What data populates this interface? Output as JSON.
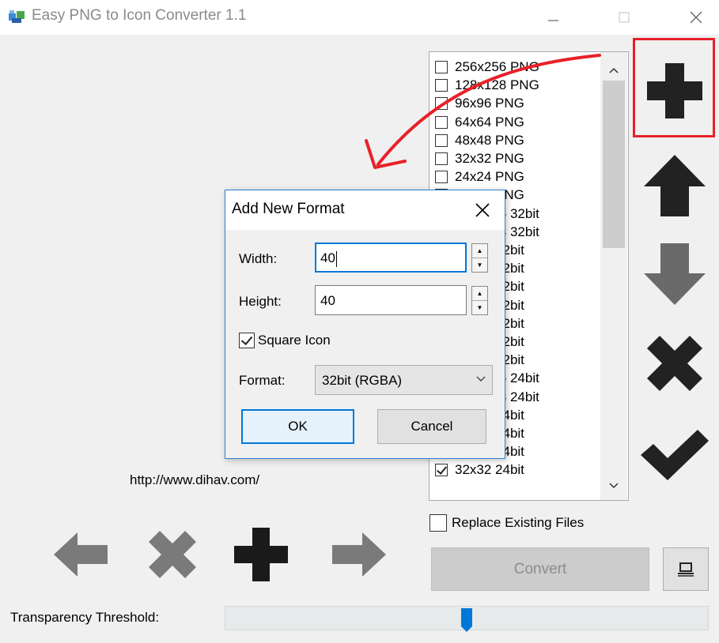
{
  "window": {
    "title": "Easy PNG to Icon Converter 1.1",
    "minimize_icon": "minimize-icon",
    "maximize_icon": "maximize-icon",
    "close_icon": "close-icon"
  },
  "format_list": {
    "items": [
      {
        "label": "256x256 PNG",
        "checked": false
      },
      {
        "label": "128x128 PNG",
        "checked": false
      },
      {
        "label": "96x96 PNG",
        "checked": false
      },
      {
        "label": "64x64 PNG",
        "checked": false
      },
      {
        "label": "48x48 PNG",
        "checked": false
      },
      {
        "label": "32x32 PNG",
        "checked": false
      },
      {
        "label": "24x24 PNG",
        "checked": false
      },
      {
        "label": "16x16 PNG",
        "checked": false
      },
      {
        "label": "256x256 32bit",
        "checked": false
      },
      {
        "label": "128x128 32bit",
        "checked": false
      },
      {
        "label": "96x96 32bit",
        "checked": false
      },
      {
        "label": "64x64 32bit",
        "checked": false
      },
      {
        "label": "48x48 32bit",
        "checked": false
      },
      {
        "label": "40x40 32bit",
        "checked": false
      },
      {
        "label": "32x32 32bit",
        "checked": false
      },
      {
        "label": "24x24 32bit",
        "checked": false
      },
      {
        "label": "16x16 32bit",
        "checked": false
      },
      {
        "label": "256x256 24bit",
        "checked": false
      },
      {
        "label": "128x128 24bit",
        "checked": false
      },
      {
        "label": "96x96 24bit",
        "checked": false
      },
      {
        "label": "64x64 24bit",
        "checked": false
      },
      {
        "label": "48x48 24bit",
        "checked": true
      },
      {
        "label": "32x32 24bit",
        "checked": true
      }
    ]
  },
  "side_toolbar": {
    "add_icon": "plus-icon",
    "up_icon": "arrow-up-icon",
    "down_icon": "arrow-down-icon",
    "delete_icon": "x-icon",
    "apply_icon": "checkmark-icon",
    "highlight_color": "#e8202a"
  },
  "dialog": {
    "title": "Add New Format",
    "width_label": "Width:",
    "width_value": "40",
    "height_label": "Height:",
    "height_value": "40",
    "square_label": "Square Icon",
    "square_checked": true,
    "format_label": "Format:",
    "format_value": "32bit (RGBA)",
    "ok_label": "OK",
    "cancel_label": "Cancel",
    "accent_color": "#0078d7"
  },
  "main": {
    "url": "http://www.dihav.com/",
    "replace_label": "Replace Existing Files",
    "replace_checked": false,
    "convert_label": "Convert",
    "threshold_label": "Transparency Threshold:",
    "threshold_level": 0.5
  },
  "bottom_toolbar": {
    "prev_icon": "arrow-left-icon",
    "remove_icon": "x-icon",
    "add_icon": "plus-icon",
    "next_icon": "arrow-right-icon"
  }
}
